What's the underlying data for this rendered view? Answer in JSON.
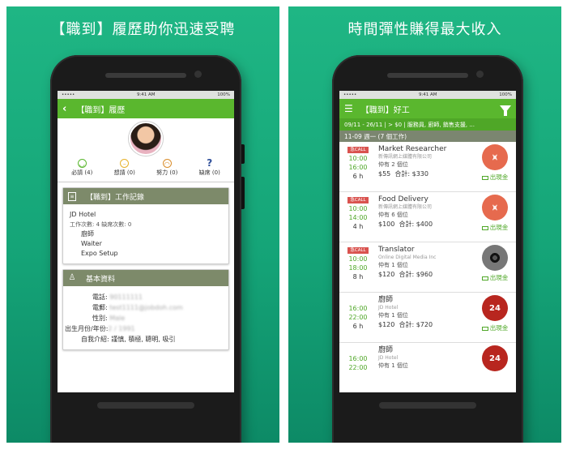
{
  "left_panel": {
    "banner": "【職到】履歷助你迅速受聘",
    "status": {
      "carrier": "•••••",
      "time": "9:41 AM",
      "battery": "100%"
    },
    "appbar_title": "【職到】履歷",
    "ratings": [
      {
        "label": "必請 (4)",
        "icon": "smile-face-icon"
      },
      {
        "label": "想請 (0)",
        "icon": "neutral-face-icon"
      },
      {
        "label": "努力 (0)",
        "icon": "frown-face-icon"
      },
      {
        "label": "缺席 (0)",
        "icon": "question-mark-icon"
      }
    ],
    "work_card": {
      "title": "【職到】工作記錄",
      "employer": "JD Hotel",
      "stats": "工作次數: 4  缺席次數: 0",
      "roles": [
        "廚師",
        "Waiter",
        "Expo Setup"
      ]
    },
    "basic_card": {
      "title": "基本資料",
      "phone_label": "電話:",
      "phone_value": "90111111",
      "email_label": "電郵:",
      "email_value": "test1111@jobdoh.com",
      "gender_label": "性別:",
      "gender_value": "Male",
      "birth_label": "出生月份/年份:",
      "birth_value": "2 / 1991",
      "intro_label": "自我介紹:",
      "intro_value": "謹慎, 積極, 聰明, 吸引"
    }
  },
  "right_panel": {
    "banner": "時間彈性賺得最大收入",
    "status": {
      "carrier": "•••••",
      "time": "9:41 AM",
      "battery": "100%"
    },
    "appbar_title": "【職到】好工",
    "filter": "09/11 - 26/11 | > $0 | 服務員, 廚師, 銷售支援, ...",
    "day_header": "11-09 週一 (7 個工作)",
    "jobs": [
      {
        "tag": "急CALL",
        "start": "10:00",
        "end": "16:00",
        "hours": "6 h",
        "title": "Market Researcher",
        "company": "新傳訊網上媒體有限公司",
        "openings": "仲有 2 個位",
        "rate": "$55",
        "total": "合計: $330",
        "cash": "出現金",
        "logo": "wave-logo-icon"
      },
      {
        "tag": "急CALL",
        "start": "10:00",
        "end": "14:00",
        "hours": "4 h",
        "title": "Food Delivery",
        "company": "新傳訊網上媒體有限公司",
        "openings": "仲有 6 個位",
        "rate": "$100",
        "total": "合計: $400",
        "cash": "出現金",
        "logo": "wave-logo-icon"
      },
      {
        "tag": "急CALL",
        "start": "10:00",
        "end": "18:00",
        "hours": "8 h",
        "title": "Translator",
        "company": "Online Digital Media Inc",
        "openings": "仲有 1 個位",
        "rate": "$120",
        "total": "合計: $960",
        "cash": "出現金",
        "logo": "dots-logo-icon"
      },
      {
        "tag": "",
        "start": "16:00",
        "end": "22:00",
        "hours": "6 h",
        "title": "廚師",
        "company": "JD Hotel",
        "openings": "仲有 1 個位",
        "rate": "$120",
        "total": "合計: $720",
        "cash": "出現金",
        "logo": "24-logo-icon",
        "logo_text": "24"
      },
      {
        "tag": "",
        "start": "16:00",
        "end": "22:00",
        "hours": "",
        "title": "廚師",
        "company": "JD Hotel",
        "openings": "仲有 1 個位",
        "rate": "",
        "total": "",
        "cash": "",
        "logo": "24-logo-icon",
        "logo_text": "24"
      }
    ]
  }
}
